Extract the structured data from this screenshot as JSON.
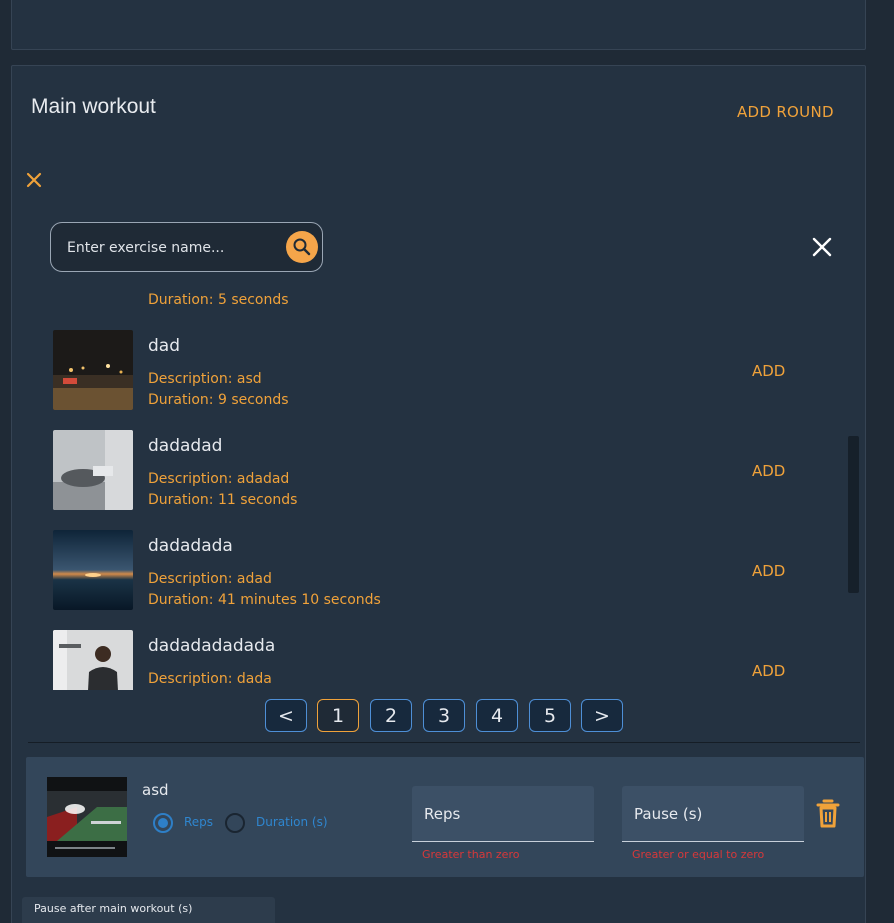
{
  "section": {
    "title": "Main workout",
    "add_round_label": "ADD ROUND"
  },
  "search": {
    "placeholder": "Enter exercise name..."
  },
  "partial_item": {
    "duration": "Duration: 5 seconds"
  },
  "exercises": [
    {
      "name": "dad",
      "description": "Description: asd",
      "duration": "Duration: 9 seconds",
      "add_label": "ADD"
    },
    {
      "name": "dadadad",
      "description": "Description: adadad",
      "duration": "Duration: 11 seconds",
      "add_label": "ADD"
    },
    {
      "name": "dadadada",
      "description": "Description: adad",
      "duration": "Duration: 41 minutes 10 seconds",
      "add_label": "ADD"
    },
    {
      "name": "dadadadadada",
      "description": "Description: dada",
      "duration": "",
      "add_label": "ADD"
    }
  ],
  "pagination": {
    "prev": "<",
    "pages": [
      "1",
      "2",
      "3",
      "4",
      "5"
    ],
    "next": ">",
    "current": "1"
  },
  "round": {
    "exercise_name": "asd",
    "mode_reps_label": "Reps",
    "mode_duration_label": "Duration (s)",
    "selected_mode": "Reps",
    "reps_field_label": "Reps",
    "reps_error": "Greater than zero",
    "pause_field_label": "Pause (s)",
    "pause_error": "Greater or equal to zero"
  },
  "pause_after": {
    "label": "Pause after main workout (s)"
  },
  "colors": {
    "accent": "#f0a23a",
    "background": "#1f2a36",
    "panel": "#243241",
    "round_card": "#33465a",
    "link_blue": "#2f86cf",
    "error": "#d8383a"
  }
}
